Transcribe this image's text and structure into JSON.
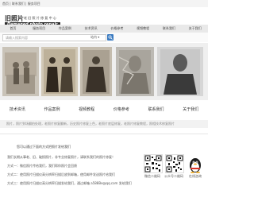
{
  "topbar": {
    "text": "首页 | 联系我们 | 服务项目"
  },
  "logo": {
    "cn": "旧照片",
    "sub": "老 旧 照 片 修 复 中 心",
    "en": "Damaged photo repair"
  },
  "nav": {
    "items": [
      "首页",
      "服务项目",
      "作品案例",
      "技术资讯",
      "价格参考",
      "视频教程",
      "联系我们",
      "关于我们"
    ]
  },
  "search": {
    "placeholder": "请输入搜索内容",
    "select_value": "站内"
  },
  "features": [
    {
      "label": "技术资讯",
      "icon": "globe-icon"
    },
    {
      "label": "作品案例",
      "icon": "photo-icon"
    },
    {
      "label": "视频教程",
      "icon": "video-icon"
    },
    {
      "label": "价格参考",
      "icon": "price-icon"
    },
    {
      "label": "联系我们",
      "icon": "phone-icon"
    },
    {
      "label": "关于我们",
      "icon": "home-icon"
    }
  ],
  "desc": "照片，照片到场翻拍处理，老照片修复翻新，历史照片修复上色，老照片底层修复，老照片修复教程，照相技术修复照片",
  "contact": {
    "title": "您可以通过下面的方式把照片发给我们",
    "lines": [
      "我们长期从事老、旧、破损照片，非专业修复照片，请联系我们的照片修复！",
      "方式一：微信照片传给我们，我们帮你照片会回馈",
      "方式二：使用照片扫描仪高分辨率扫描后放到邮箱，使用邮件发送照片给我们",
      "方式三：使用照片扫描仪高分辨率扫描发给我们，通过邮箱 a588Be@qq.com 发给我们"
    ]
  },
  "qrcodes": [
    {
      "label": "微信二维码"
    },
    {
      "label": "公众号二维码"
    }
  ],
  "wechat": {
    "label": "在线咨询"
  }
}
